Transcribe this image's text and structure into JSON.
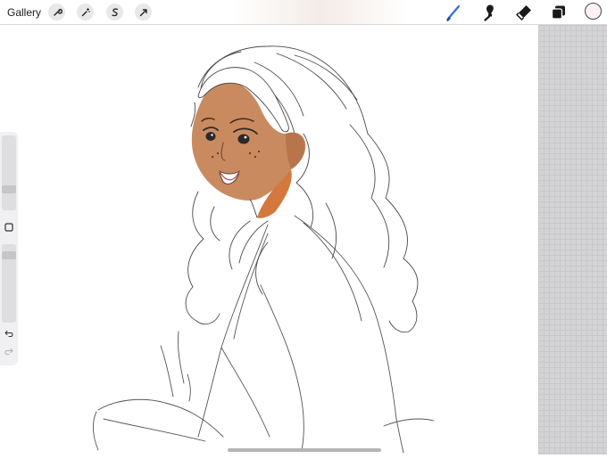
{
  "toolbar": {
    "gallery_label": "Gallery",
    "left_tools": [
      "wrench-icon",
      "magic-wand-icon",
      "selection-icon",
      "transform-arrow-icon"
    ],
    "right_tools": [
      "brush-icon",
      "smudge-icon",
      "eraser-icon",
      "layers-icon"
    ],
    "active_tool": "brush-icon",
    "accent_color": "#2f6fd6",
    "current_color": "#fff0f6"
  },
  "sidebar": {
    "controls": [
      "brush-size-slider",
      "modify-square-button",
      "opacity-slider",
      "undo-icon",
      "redo-icon"
    ],
    "brush_size": 0.25,
    "opacity": 0.9
  },
  "canvas": {
    "background": "#ffffff",
    "skin_color": "#c98a5f",
    "shadow_color": "#d4783e",
    "line_color": "#3a3a3a"
  },
  "reference_panel": {
    "color": "#d4d4d6"
  }
}
